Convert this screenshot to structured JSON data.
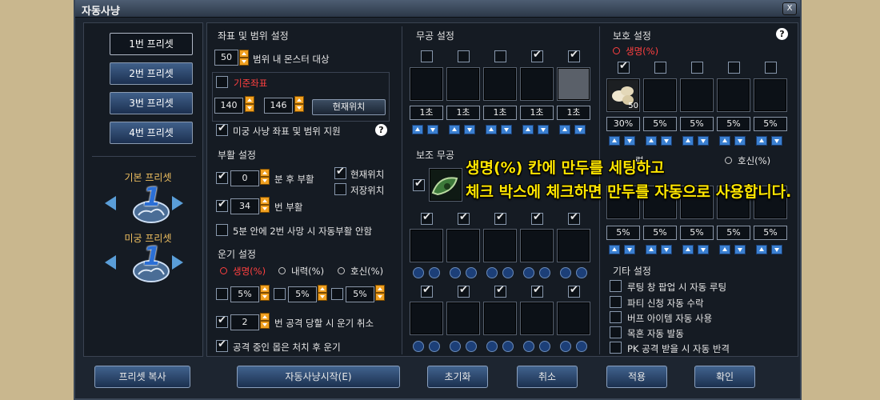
{
  "window": {
    "title": "자동사냥",
    "close_label": "X"
  },
  "presets": {
    "items": [
      "1번 프리셋",
      "2번 프리셋",
      "3번 프리셋",
      "4번 프리셋"
    ],
    "basic_title": "기본 프리셋",
    "dungeon_title": "미궁 프리셋",
    "basic_number": "1",
    "dungeon_number": "1"
  },
  "coords": {
    "title": "좌표 및 범위 설정",
    "range_value": "50",
    "range_label": "범위 내 몬스터 대상",
    "base_label": "기준좌표",
    "x_value": "140",
    "y_value": "146",
    "current_pos_button": "현재위치",
    "dungeon_label": "미궁 사냥 좌표 및 범위 지원",
    "help": "?"
  },
  "revive": {
    "title": "부활 설정",
    "minutes_value": "0",
    "minutes_label": "분 후 부활",
    "current_pos": "현재위치",
    "saved_pos": "저장위치",
    "count_value": "34",
    "count_label": "번 부활",
    "rule_label": "5분 안에 2번 사망 시 자동부활 안함"
  },
  "qi": {
    "title": "운기 설정",
    "opt_life": "생명(%)",
    "opt_inner": "내력(%)",
    "opt_protect": "호신(%)",
    "pct1": "5%",
    "pct2": "5%",
    "pct3": "5%",
    "attack_value": "2",
    "attack_label": "번 공격 당할 시 운기 취소",
    "kill_label": "공격 중인 몹은 처치 후 운기"
  },
  "martial": {
    "title": "무공 설정",
    "timers": [
      "1초",
      "1초",
      "1초",
      "1초",
      "1초"
    ],
    "aux_title": "보조 무공"
  },
  "protect": {
    "title": "보호 설정",
    "life_label": "생명(%)",
    "help": "?",
    "item_count": "50",
    "pcts": [
      "30%",
      "5%",
      "5%",
      "5%",
      "5%"
    ],
    "inner_label_partial": "력",
    "protect_label": "호신(%)",
    "pcts2": [
      "5%",
      "5%",
      "5%",
      "5%",
      "5%"
    ]
  },
  "etc": {
    "title": "기타 설정",
    "options": [
      "루팅 창 팝업 시 자동 루팅",
      "파티 신청 자동 수락",
      "버프 아이템 자동 사용",
      "목혼 자동 발동",
      "PK 공격 받을 시 자동 반격"
    ]
  },
  "bottom": {
    "copy_preset": "프리셋 복사",
    "start": "자동사냥시작(E)",
    "reset": "초기화",
    "cancel": "취소",
    "apply": "적용",
    "ok": "확인"
  },
  "overlay": {
    "line1": "생명(%) 칸에 만두를 세팅하고",
    "line2": "체크 박스에 체크하면 만두를 자동으로 사용합니다."
  },
  "colors": {
    "accent": "#f0a020",
    "label_red": "#ff4040",
    "overlay_text": "#ffe600",
    "title_gold": "#f0c060"
  }
}
